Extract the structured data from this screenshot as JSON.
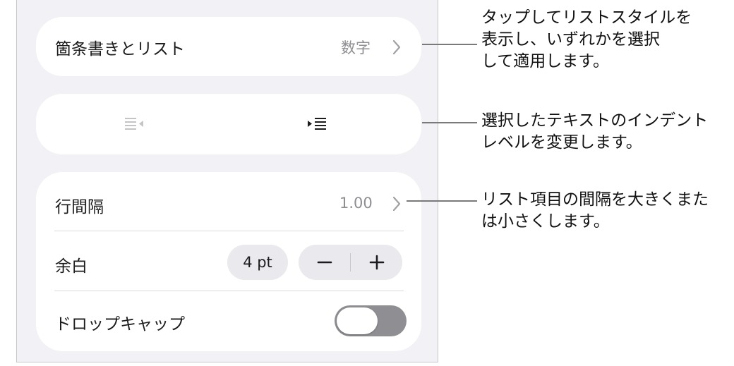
{
  "bullets_row": {
    "label": "箇条書きとリスト",
    "value": "数字"
  },
  "indent_row": {
    "decrease_icon": "outdent-icon",
    "increase_icon": "indent-icon"
  },
  "line_spacing_row": {
    "label": "行間隔",
    "value": "1.00"
  },
  "margin_row": {
    "label": "余白",
    "value": "4 pt",
    "minus_icon": "minus-icon",
    "plus_icon": "plus-icon"
  },
  "drop_cap_row": {
    "label": "ドロップキャップ",
    "toggle_on": false
  },
  "callouts": [
    {
      "text": "タップしてリストスタイルを\n表示し、いずれかを選択\nして適用します。"
    },
    {
      "text": "選択したテキストのインデント\nレベルを変更します。"
    },
    {
      "text": "リスト項目の間隔を大きくまた\nは小さくします。"
    }
  ]
}
